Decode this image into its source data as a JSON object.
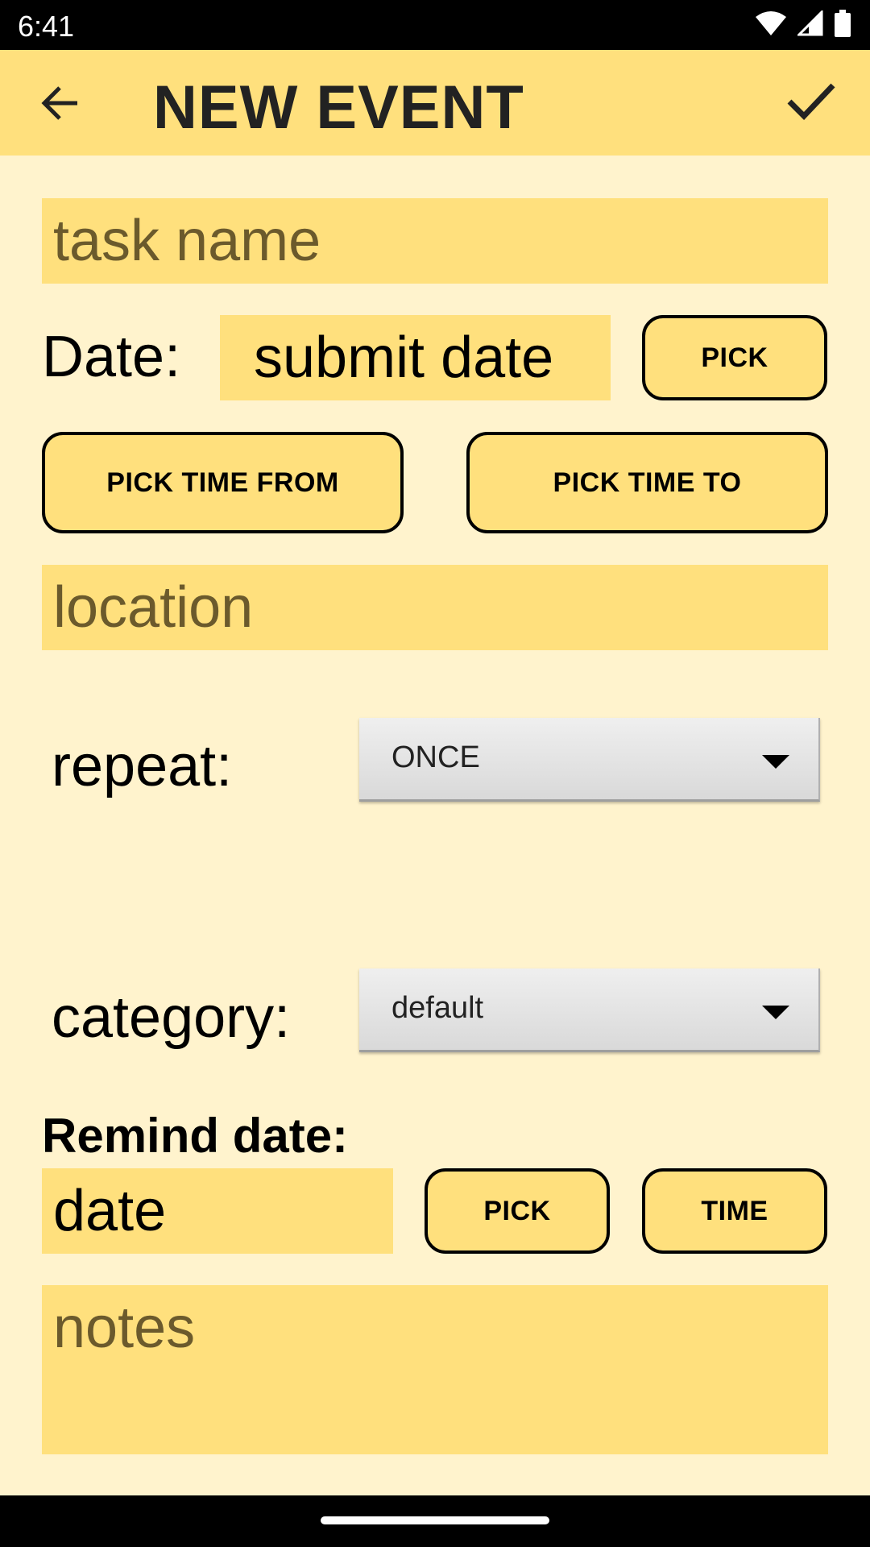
{
  "status_bar": {
    "time": "6:41",
    "icons": [
      "wifi-icon",
      "signal-icon",
      "battery-icon"
    ]
  },
  "app_bar": {
    "title": "NEW EVENT",
    "back_icon": "arrow-back-icon",
    "confirm_icon": "check-icon"
  },
  "form": {
    "task_name_placeholder": "task name",
    "date_label": "Date:",
    "date_value": "submit date",
    "pick_date_label": "PICK",
    "pick_time_from_label": "PICK TIME FROM",
    "pick_time_to_label": "PICK TIME TO",
    "location_placeholder": "location",
    "repeat_label": "repeat:",
    "repeat_value": "ONCE",
    "category_label": "category:",
    "category_value": "default",
    "remind_label": "Remind date:",
    "remind_date_value": "date",
    "remind_pick_label": "PICK",
    "remind_time_label": "TIME",
    "notes_placeholder": "notes"
  },
  "colors": {
    "background": "#FFF3CD",
    "accent": "#FFE07D",
    "placeholder": "#6B5A2C"
  }
}
